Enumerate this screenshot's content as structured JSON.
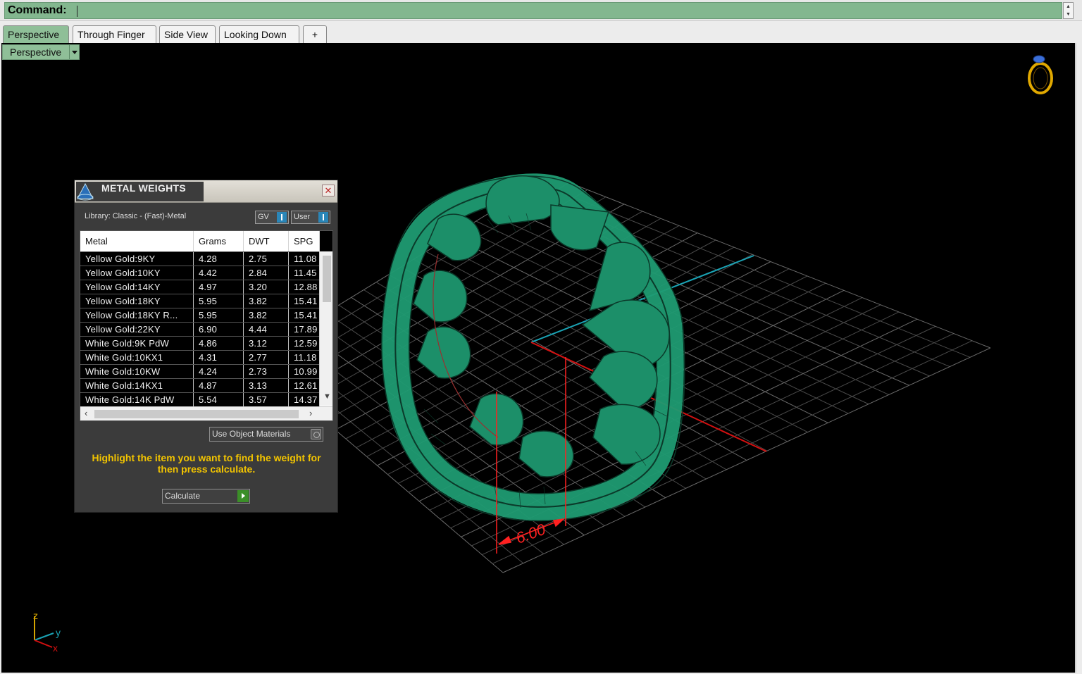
{
  "command": {
    "label": "Command:"
  },
  "tabs": [
    {
      "label": "Perspective",
      "active": true
    },
    {
      "label": "Through Finger",
      "active": false
    },
    {
      "label": "Side View",
      "active": false
    },
    {
      "label": "Looking Down",
      "active": false
    },
    {
      "label": "+",
      "active": false
    }
  ],
  "viewport": {
    "title": "Perspective",
    "dimension_label": "6.00",
    "axis_labels": {
      "z": "z",
      "y": "y",
      "x": "x"
    }
  },
  "metal_weights": {
    "title": "METAL WEIGHTS",
    "library": "Library: Classic - (Fast)-Metal",
    "toggle_gv": "GV",
    "toggle_user": "User",
    "columns": [
      "Metal",
      "Grams",
      "DWT",
      "SPG"
    ],
    "rows": [
      [
        "Yellow Gold:9KY",
        "4.28",
        "2.75",
        "11.08"
      ],
      [
        "Yellow Gold:10KY",
        "4.42",
        "2.84",
        "11.45"
      ],
      [
        "Yellow Gold:14KY",
        "4.97",
        "3.20",
        "12.88"
      ],
      [
        "Yellow Gold:18KY",
        "5.95",
        "3.82",
        "15.41"
      ],
      [
        "Yellow Gold:18KY R...",
        "5.95",
        "3.82",
        "15.41"
      ],
      [
        "Yellow Gold:22KY",
        "6.90",
        "4.44",
        "17.89"
      ],
      [
        "White Gold:9K PdW",
        "4.86",
        "3.12",
        "12.59"
      ],
      [
        "White Gold:10KX1",
        "4.31",
        "2.77",
        "11.18"
      ],
      [
        "White Gold:10KW",
        "4.24",
        "2.73",
        "10.99"
      ],
      [
        "White Gold:14KX1",
        "4.87",
        "3.13",
        "12.61"
      ],
      [
        "White Gold:14K PdW",
        "5.54",
        "3.57",
        "14.37"
      ]
    ],
    "use_object_materials": "Use Object Materials",
    "hint": "Highlight the item you want to find the weight for then press calculate.",
    "calculate": "Calculate"
  },
  "colors": {
    "command_bg": "#83b78f",
    "tab_active": "#8fbf98",
    "ring": "#1f9b72",
    "hint": "#f2c400",
    "dimension": "#ff2020"
  }
}
